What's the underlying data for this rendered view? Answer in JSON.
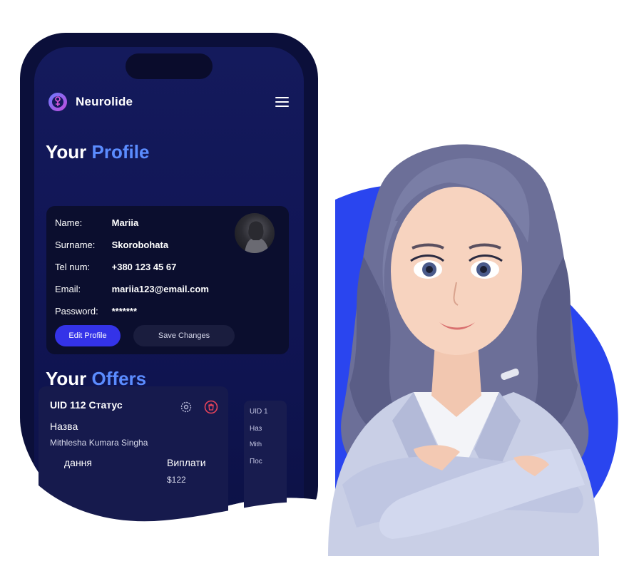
{
  "header": {
    "brand": "Neurolide",
    "logo_icon": "neurolide-logo-icon",
    "menu_icon": "hamburger-menu-icon"
  },
  "profile": {
    "title_part1": "Your",
    "title_part2": "Profile",
    "fields": [
      {
        "key": "Name:",
        "value": "Mariia"
      },
      {
        "key": "Surname:",
        "value": "Skorobohata"
      },
      {
        "key": "Tel num:",
        "value": "+380 123 45 67"
      },
      {
        "key": "Email:",
        "value": "mariia123@email.com"
      },
      {
        "key": "Password:",
        "value": "*******"
      }
    ],
    "edit_label": "Edit Profile",
    "save_label": "Save Changes"
  },
  "offers": {
    "title_part1": "Your",
    "title_part2": "Offers",
    "card": {
      "title": "UID 112 Статус",
      "name_label": "Назва",
      "name_value": "Mithlesha Kumara Singha",
      "left_label": "дання",
      "right_label": "Виплати",
      "right_value": "$122",
      "settings_icon": "gear-icon",
      "delete_icon": "trash-icon"
    },
    "card2": {
      "line1": "UID 1",
      "line2": "Наз",
      "line3": "Mith",
      "line4": "Пос"
    }
  },
  "colors": {
    "accent": "#5b8cff",
    "button_primary": "#3433e8",
    "background_blob": "#2a45ef",
    "delete_icon": "#e8435a"
  }
}
